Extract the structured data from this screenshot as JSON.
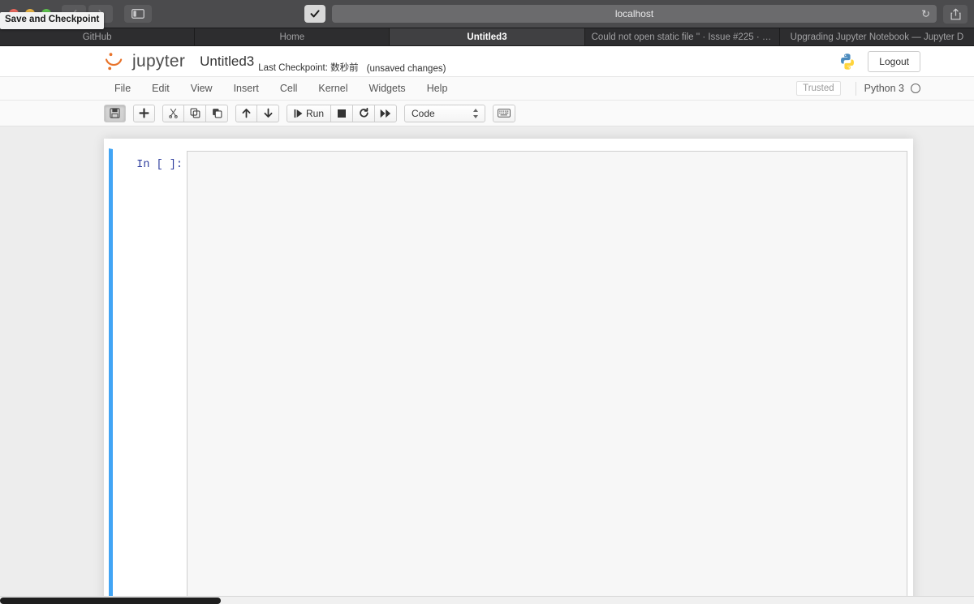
{
  "browser": {
    "url": "localhost",
    "tooltip": "Save and Checkpoint",
    "icons": {
      "back": "chevron-left-icon",
      "forward": "chevron-right-icon",
      "sidebar": "sidebar-toggle-icon",
      "reader": "reader-checkbox-icon",
      "reload": "reload-icon",
      "share": "share-icon"
    },
    "tabs": [
      {
        "label": "GitHub",
        "active": false
      },
      {
        "label": "Home",
        "active": false
      },
      {
        "label": "Untitled3",
        "active": true
      },
      {
        "label": "Could not open static file '' · Issue #225 · ju...",
        "active": false
      },
      {
        "label": "Upgrading Jupyter Notebook — Jupyter D",
        "active": false
      }
    ]
  },
  "jupyter": {
    "logo_text": "jupyter",
    "notebook_name": "Untitled3",
    "checkpoint": "Last Checkpoint: 数秒前",
    "modified_status": "(unsaved changes)",
    "logout_label": "Logout",
    "kernel_logo": "python-logo-icon",
    "menu": [
      "File",
      "Edit",
      "View",
      "Insert",
      "Cell",
      "Kernel",
      "Widgets",
      "Help"
    ],
    "trusted_label": "Trusted",
    "kernel_name": "Python 3",
    "kernel_status": "idle",
    "toolbar": {
      "groups": [
        {
          "buttons": [
            {
              "name": "save-and-checkpoint-button",
              "icon": "floppy-disk-icon",
              "label": "",
              "pressed": true
            }
          ]
        },
        {
          "buttons": [
            {
              "name": "insert-cell-below-button",
              "icon": "plus-icon",
              "label": "",
              "pressed": false
            }
          ]
        },
        {
          "buttons": [
            {
              "name": "cut-cell-button",
              "icon": "scissors-icon",
              "label": "",
              "pressed": false
            },
            {
              "name": "copy-cell-button",
              "icon": "copy-icon",
              "label": "",
              "pressed": false
            },
            {
              "name": "paste-cell-button",
              "icon": "paste-icon",
              "label": "",
              "pressed": false
            }
          ]
        },
        {
          "buttons": [
            {
              "name": "move-cell-up-button",
              "icon": "arrow-up-icon",
              "label": "",
              "pressed": false
            },
            {
              "name": "move-cell-down-button",
              "icon": "arrow-down-icon",
              "label": "",
              "pressed": false
            }
          ]
        },
        {
          "buttons": [
            {
              "name": "run-cell-button",
              "icon": "run-icon",
              "label": "Run",
              "pressed": false
            },
            {
              "name": "interrupt-kernel-button",
              "icon": "stop-square-icon",
              "label": "",
              "pressed": false
            },
            {
              "name": "restart-kernel-button",
              "icon": "restart-circle-icon",
              "label": "",
              "pressed": false
            },
            {
              "name": "restart-and-run-all-button",
              "icon": "fast-forward-icon",
              "label": "",
              "pressed": false
            }
          ]
        }
      ],
      "cell_type": "Code",
      "command_palette_icon": "keyboard-icon"
    },
    "cell": {
      "prompt": "In [ ]:",
      "source": "",
      "selected": true
    }
  }
}
